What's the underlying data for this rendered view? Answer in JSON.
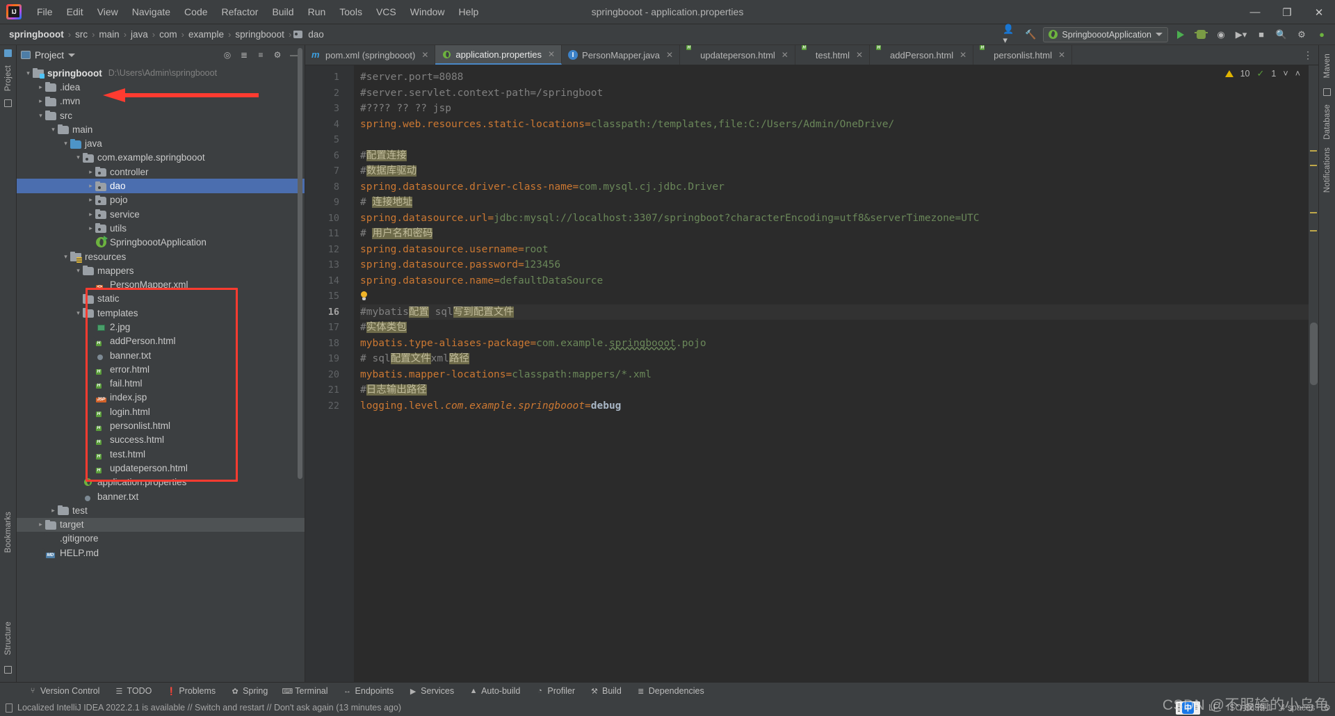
{
  "window": {
    "title": "springbooot - application.properties",
    "minimize": "—",
    "maximize": "❐",
    "close": "✕"
  },
  "menubar": [
    "File",
    "Edit",
    "View",
    "Navigate",
    "Code",
    "Refactor",
    "Build",
    "Run",
    "Tools",
    "VCS",
    "Window",
    "Help"
  ],
  "breadcrumb": {
    "items": [
      "springbooot",
      "src",
      "main",
      "java",
      "com",
      "example",
      "springbooot",
      "dao"
    ],
    "separator": "›"
  },
  "run_config": {
    "name": "SpringboootApplication",
    "chevron": "▾"
  },
  "project_panel": {
    "title": "Project",
    "chevron": "▾",
    "tree": [
      {
        "depth": 0,
        "chevron": "˅",
        "icon": "module-icon",
        "label": "springbooot",
        "bold": true,
        "path": "D:\\Users\\Admin\\springbooot"
      },
      {
        "depth": 1,
        "chevron": "›",
        "icon": "folder-icon",
        "label": ".idea"
      },
      {
        "depth": 1,
        "chevron": "›",
        "icon": "folder-icon",
        "label": ".mvn"
      },
      {
        "depth": 1,
        "chevron": "˅",
        "icon": "folder-icon",
        "label": "src"
      },
      {
        "depth": 2,
        "chevron": "˅",
        "icon": "folder-icon",
        "label": "main"
      },
      {
        "depth": 3,
        "chevron": "˅",
        "icon": "source-folder-icon",
        "label": "java"
      },
      {
        "depth": 4,
        "chevron": "˅",
        "icon": "package-icon",
        "label": "com.example.springbooot"
      },
      {
        "depth": 5,
        "chevron": "›",
        "icon": "package-icon",
        "label": "controller"
      },
      {
        "depth": 5,
        "chevron": "›",
        "icon": "package-icon",
        "label": "dao",
        "selected": true
      },
      {
        "depth": 5,
        "chevron": "›",
        "icon": "package-icon",
        "label": "pojo"
      },
      {
        "depth": 5,
        "chevron": "›",
        "icon": "package-icon",
        "label": "service"
      },
      {
        "depth": 5,
        "chevron": "›",
        "icon": "package-icon",
        "label": "utils"
      },
      {
        "depth": 5,
        "chevron": "",
        "icon": "spring-class-icon",
        "label": "SpringboootApplication"
      },
      {
        "depth": 3,
        "chevron": "˅",
        "icon": "resources-folder-icon",
        "label": "resources"
      },
      {
        "depth": 4,
        "chevron": "˅",
        "icon": "folder-icon",
        "label": "mappers"
      },
      {
        "depth": 5,
        "chevron": "",
        "icon": "xml-file-icon",
        "label": "PersonMapper.xml"
      },
      {
        "depth": 4,
        "chevron": "",
        "icon": "folder-icon",
        "label": "static"
      },
      {
        "depth": 4,
        "chevron": "˅",
        "icon": "folder-icon",
        "label": "templates"
      },
      {
        "depth": 5,
        "chevron": "",
        "icon": "image-file-icon",
        "label": "2.jpg"
      },
      {
        "depth": 5,
        "chevron": "",
        "icon": "html-file-icon",
        "label": "addPerson.html"
      },
      {
        "depth": 5,
        "chevron": "",
        "icon": "text-file-icon",
        "label": "banner.txt"
      },
      {
        "depth": 5,
        "chevron": "",
        "icon": "html-file-icon",
        "label": "error.html"
      },
      {
        "depth": 5,
        "chevron": "",
        "icon": "html-file-icon",
        "label": "fail.html"
      },
      {
        "depth": 5,
        "chevron": "",
        "icon": "jsp-file-icon",
        "label": "index.jsp"
      },
      {
        "depth": 5,
        "chevron": "",
        "icon": "html-file-icon",
        "label": "login.html"
      },
      {
        "depth": 5,
        "chevron": "",
        "icon": "html-file-icon",
        "label": "personlist.html"
      },
      {
        "depth": 5,
        "chevron": "",
        "icon": "html-file-icon",
        "label": "success.html"
      },
      {
        "depth": 5,
        "chevron": "",
        "icon": "html-file-icon",
        "label": "test.html"
      },
      {
        "depth": 5,
        "chevron": "",
        "icon": "html-file-icon",
        "label": "updateperson.html"
      },
      {
        "depth": 4,
        "chevron": "",
        "icon": "properties-file-icon",
        "label": "application.properties"
      },
      {
        "depth": 4,
        "chevron": "",
        "icon": "text-file-icon",
        "label": "banner.txt"
      },
      {
        "depth": 2,
        "chevron": "›",
        "icon": "folder-icon",
        "label": "test"
      },
      {
        "depth": 1,
        "chevron": "›",
        "icon": "folder-icon",
        "label": "target",
        "highlighted": true
      },
      {
        "depth": 1,
        "chevron": "",
        "icon": "git-file-icon",
        "label": ".gitignore"
      },
      {
        "depth": 1,
        "chevron": "",
        "icon": "md-file-icon",
        "label": "HELP.md"
      }
    ]
  },
  "editor": {
    "tabs": [
      {
        "icon": "maven-icon",
        "label": "pom.xml (springbooot)",
        "active": false
      },
      {
        "icon": "properties-icon",
        "label": "application.properties",
        "active": true
      },
      {
        "icon": "java-class-icon",
        "label": "PersonMapper.java",
        "active": false
      },
      {
        "icon": "html-icon",
        "label": "updateperson.html",
        "active": false
      },
      {
        "icon": "html-icon",
        "label": "test.html",
        "active": false
      },
      {
        "icon": "html-icon",
        "label": "addPerson.html",
        "active": false
      },
      {
        "icon": "html-icon",
        "label": "personlist.html",
        "active": false
      }
    ],
    "tab_close": "✕",
    "tabs_more": "⋮",
    "inspection": {
      "warnings": "10",
      "checks": "1",
      "chevron_down": "˅",
      "chevron_up": "˄"
    },
    "current_line": 16,
    "lines": [
      {
        "n": 1,
        "tokens": [
          {
            "t": "comment",
            "v": "#server.port=8088"
          }
        ]
      },
      {
        "n": 2,
        "tokens": [
          {
            "t": "comment",
            "v": "#server.servlet.context-path=/springboot"
          }
        ]
      },
      {
        "n": 3,
        "tokens": [
          {
            "t": "comment",
            "v": "#???? ?? ?? jsp"
          }
        ]
      },
      {
        "n": 4,
        "tokens": [
          {
            "t": "key",
            "v": "spring.web.resources.static-locations"
          },
          {
            "t": "op",
            "v": "="
          },
          {
            "t": "value",
            "v": "classpath:/templates,file:C:/Users/Admin/OneDrive/"
          }
        ]
      },
      {
        "n": 5,
        "tokens": []
      },
      {
        "n": 6,
        "tokens": [
          {
            "t": "comment",
            "v": "#"
          },
          {
            "t": "comment-hl",
            "v": "配置连接"
          }
        ]
      },
      {
        "n": 7,
        "tokens": [
          {
            "t": "comment",
            "v": "#"
          },
          {
            "t": "comment-hl",
            "v": "数据库驱动"
          }
        ]
      },
      {
        "n": 8,
        "tokens": [
          {
            "t": "key",
            "v": "spring.datasource.driver-class-name"
          },
          {
            "t": "op",
            "v": "="
          },
          {
            "t": "value",
            "v": "com.mysql.cj.jdbc.Driver"
          }
        ]
      },
      {
        "n": 9,
        "tokens": [
          {
            "t": "comment",
            "v": "# "
          },
          {
            "t": "comment-hl",
            "v": "连接地址"
          }
        ]
      },
      {
        "n": 10,
        "tokens": [
          {
            "t": "key",
            "v": "spring.datasource.url"
          },
          {
            "t": "op",
            "v": "="
          },
          {
            "t": "value",
            "v": "jdbc:mysql://localhost:3307/springboot?characterEncoding=utf8&serverTimezone=UTC"
          }
        ]
      },
      {
        "n": 11,
        "tokens": [
          {
            "t": "comment",
            "v": "# "
          },
          {
            "t": "comment-hl",
            "v": "用户名和密码"
          }
        ]
      },
      {
        "n": 12,
        "tokens": [
          {
            "t": "key",
            "v": "spring.datasource.username"
          },
          {
            "t": "op",
            "v": "="
          },
          {
            "t": "value",
            "v": "root"
          }
        ]
      },
      {
        "n": 13,
        "tokens": [
          {
            "t": "key",
            "v": "spring.datasource.password"
          },
          {
            "t": "op",
            "v": "="
          },
          {
            "t": "value",
            "v": "123456"
          }
        ]
      },
      {
        "n": 14,
        "tokens": [
          {
            "t": "key",
            "v": "spring.datasource.name"
          },
          {
            "t": "op",
            "v": "="
          },
          {
            "t": "value",
            "v": "defaultDataSource"
          }
        ]
      },
      {
        "n": 15,
        "tokens": [
          {
            "t": "bulb",
            "v": ""
          }
        ]
      },
      {
        "n": 16,
        "tokens": [
          {
            "t": "comment",
            "v": "#mybatis"
          },
          {
            "t": "comment-hl",
            "v": "配置"
          },
          {
            "t": "comment",
            "v": " sql"
          },
          {
            "t": "comment-hl",
            "v": "写到配置文件"
          }
        ]
      },
      {
        "n": 17,
        "tokens": [
          {
            "t": "comment",
            "v": "#"
          },
          {
            "t": "comment-hl",
            "v": "实体类包"
          }
        ]
      },
      {
        "n": 18,
        "tokens": [
          {
            "t": "key",
            "v": "mybatis.type-aliases-package"
          },
          {
            "t": "op",
            "v": "="
          },
          {
            "t": "value",
            "v": "com.example."
          },
          {
            "t": "value-squiggle",
            "v": "springbooot"
          },
          {
            "t": "value",
            "v": ".pojo"
          }
        ]
      },
      {
        "n": 19,
        "tokens": [
          {
            "t": "comment",
            "v": "# sql"
          },
          {
            "t": "comment-hl",
            "v": "配置文件"
          },
          {
            "t": "comment",
            "v": "xml"
          },
          {
            "t": "comment-hl",
            "v": "路径"
          }
        ]
      },
      {
        "n": 20,
        "tokens": [
          {
            "t": "key",
            "v": "mybatis.mapper-locations"
          },
          {
            "t": "op",
            "v": "="
          },
          {
            "t": "value",
            "v": "classpath:mappers/*.xml"
          }
        ]
      },
      {
        "n": 21,
        "tokens": [
          {
            "t": "comment",
            "v": "#"
          },
          {
            "t": "comment-hl",
            "v": "日志输出路径"
          }
        ]
      },
      {
        "n": 22,
        "tokens": [
          {
            "t": "key",
            "v": "logging.level."
          },
          {
            "t": "key-italic",
            "v": "com.example.springbooot"
          },
          {
            "t": "op",
            "v": "="
          },
          {
            "t": "bold",
            "v": "debug"
          }
        ]
      }
    ]
  },
  "left_strip": {
    "labels": [
      "Project",
      "Bookmarks",
      "Structure"
    ]
  },
  "right_strip": {
    "labels": [
      "Maven",
      "Database",
      "Notifications"
    ]
  },
  "bottom_bar": {
    "items": [
      {
        "icon": "branch-icon",
        "label": "Version Control"
      },
      {
        "icon": "list-icon",
        "label": "TODO"
      },
      {
        "icon": "problems-icon",
        "label": "Problems"
      },
      {
        "icon": "spring-icon",
        "label": "Spring"
      },
      {
        "icon": "terminal-icon",
        "label": "Terminal"
      },
      {
        "icon": "endpoints-icon",
        "label": "Endpoints"
      },
      {
        "icon": "services-icon",
        "label": "Services"
      },
      {
        "icon": "autobuild-icon",
        "label": "Auto-build"
      },
      {
        "icon": "profiler-icon",
        "label": "Profiler"
      },
      {
        "icon": "build-icon",
        "label": "Build"
      },
      {
        "icon": "dependencies-icon",
        "label": "Dependencies"
      }
    ]
  },
  "status_bar": {
    "message": "Localized IntelliJ IDEA 2022.2.1 is available // Switch and restart // Don't ask again (13 minutes ago)",
    "line_sep": "LF",
    "encoding": "ISO-8859-1",
    "indent": "4 spaces",
    "ime_label": "中",
    "watermark": "CSDN @不服输的小乌龟"
  },
  "colors": {
    "accent": "#4b6eaf",
    "annotation": "#ff3b30",
    "comment": "#808080",
    "key": "#cc7832",
    "value": "#6a8759",
    "highlight": "#6e6b4a",
    "bg_editor": "#2b2b2b",
    "bg_chrome": "#3c3f41"
  }
}
